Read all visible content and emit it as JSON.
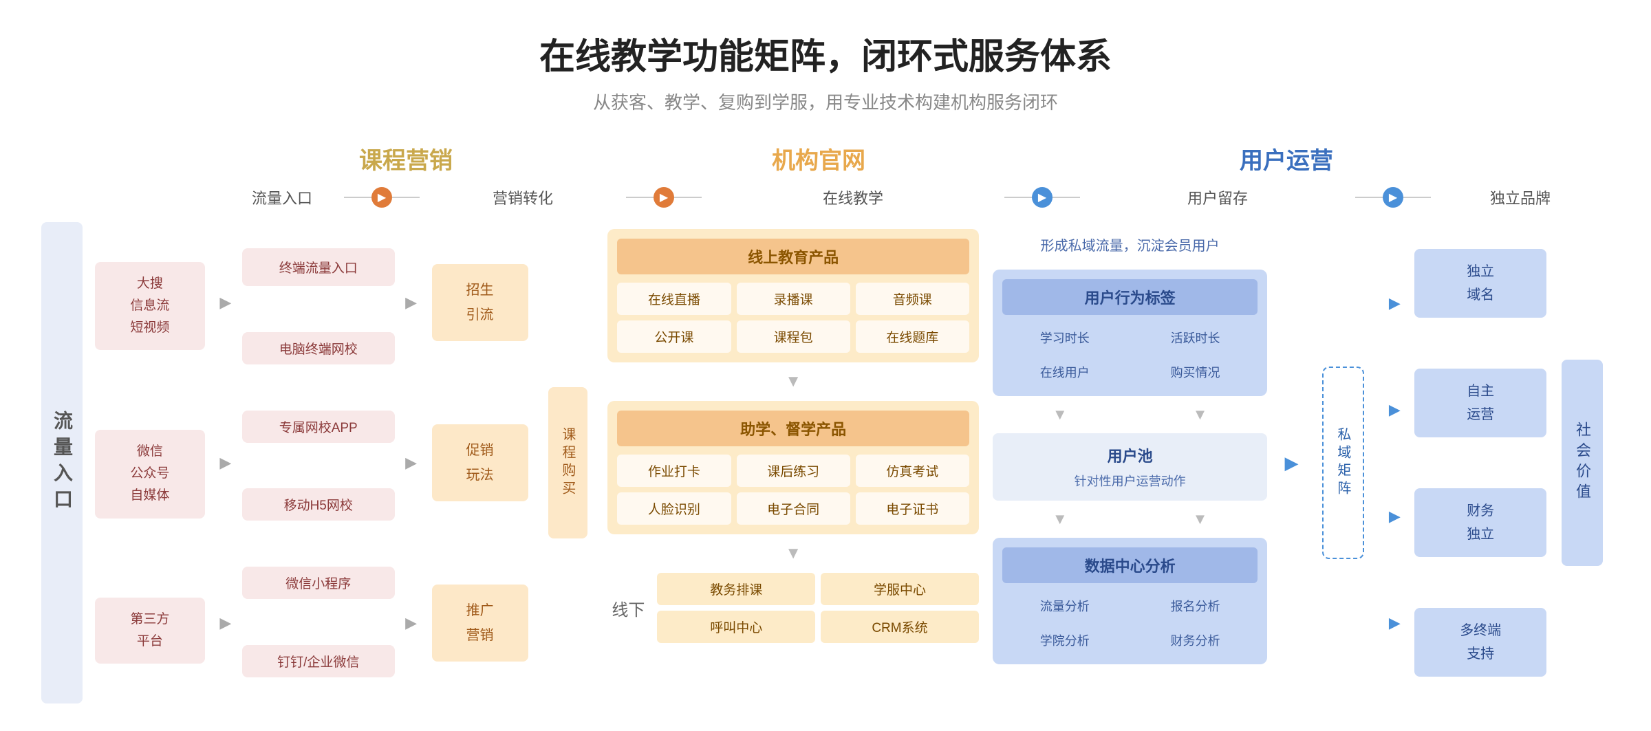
{
  "header": {
    "title": "在线教学功能矩阵，闭环式服务体系",
    "subtitle": "从获客、教学、复购到学服，用专业技术构建机构服务闭环"
  },
  "sections": {
    "kecheng": "课程营销",
    "jigou": "机构官网",
    "yonghu": "用户运营"
  },
  "flow_steps": {
    "step1": "流量入口",
    "step2": "营销转化",
    "step3": "在线教学",
    "step4": "用户留存",
    "step5": "独立品牌"
  },
  "side_label_left": "流量入口",
  "traffic_sources": [
    {
      "text": "大搜\n信息流\n短视频"
    },
    {
      "text": "微信\n公众号\n自媒体"
    },
    {
      "text": "第三方\n平台"
    }
  ],
  "terminal_items": [
    "终端流量入口",
    "电脑终端网校",
    "专属网校APP",
    "移动H5网校",
    "微信小程序",
    "钉钉/企业微信"
  ],
  "conversion": {
    "zhaoSheng": "招生\n引流",
    "cuXiao": "促销\n玩法",
    "tuiGuang": "推广\n营销"
  },
  "purchase_label": "课程购买",
  "online_education": {
    "section1_title": "线上教育产品",
    "items1": [
      "在线直播",
      "录播课",
      "音频课",
      "公开课",
      "课程包",
      "在线题库"
    ],
    "section2_title": "助学、督学产品",
    "items2": [
      "作业打卡",
      "课后练习",
      "仿真考试",
      "人脸识别",
      "电子合同",
      "电子证书"
    ],
    "offline_label": "线下",
    "offline_items": [
      "教务排课",
      "学服中心",
      "呼叫中心",
      "CRM系统"
    ]
  },
  "user_retention": {
    "top_text": "形成私域流量，沉淀会员用户",
    "tag_title": "用户行为标签",
    "tags": [
      "学习时长",
      "活跃时长",
      "在线用户",
      "购买情况"
    ],
    "pool_title": "用户池",
    "pool_sub": "针对性用户运营动作",
    "data_title": "数据中心分析",
    "data_items": [
      "流量分析",
      "报名分析",
      "学院分析",
      "财务分析"
    ]
  },
  "private_label": "私域矩阵",
  "brand_items": [
    "独立\n域名",
    "自主\n运营",
    "财务\n独立",
    "多终端\n支持"
  ],
  "social_label": "社会价值"
}
